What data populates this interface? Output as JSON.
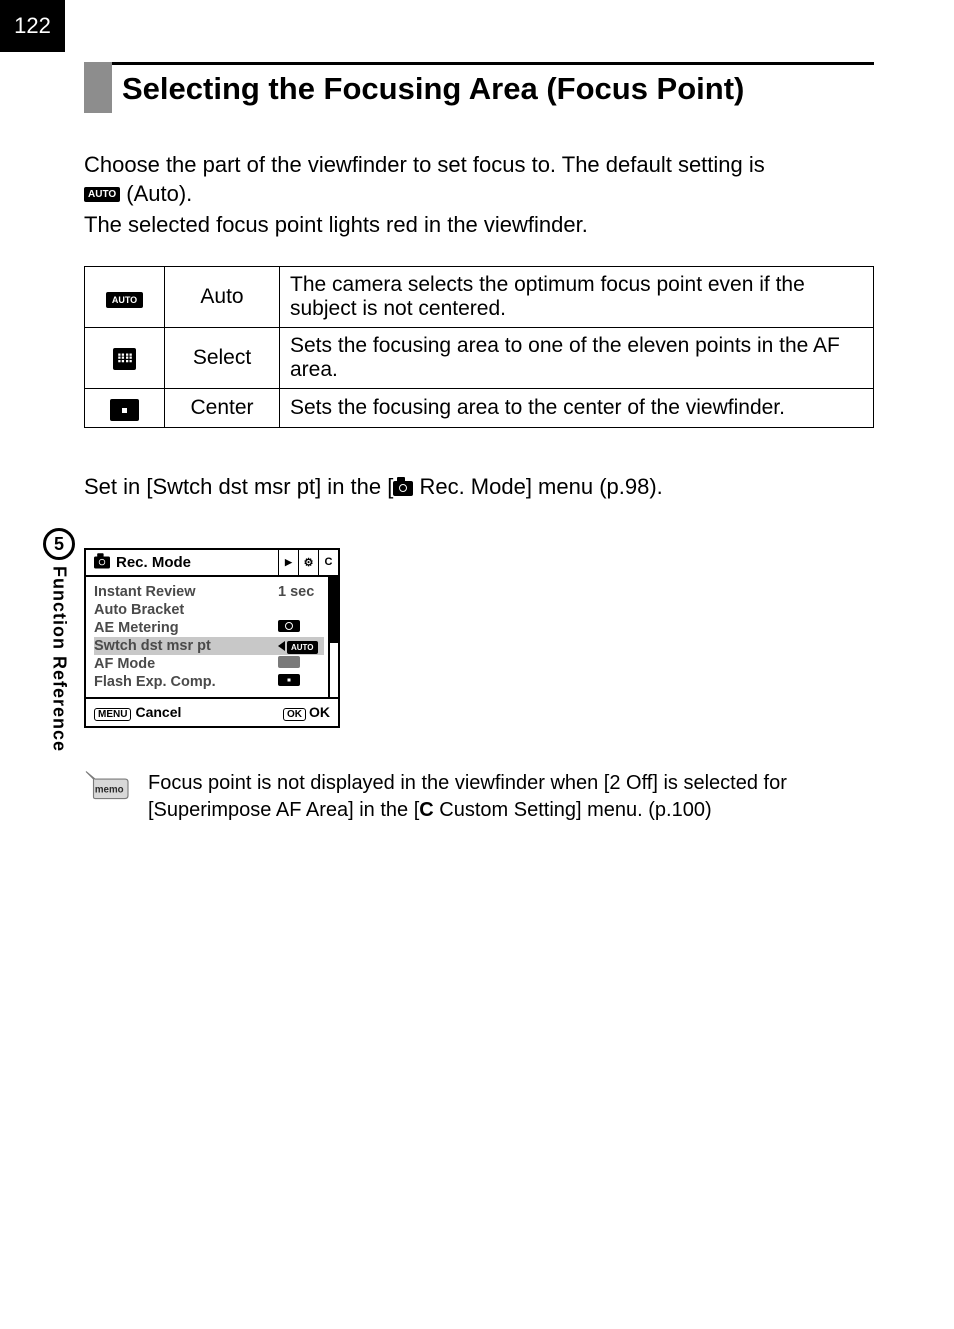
{
  "page_number": "122",
  "section_title": "Selecting the Focusing Area (Focus Point)",
  "intro_line1": "Choose the part of the viewfinder to set focus to. The default setting is",
  "intro_auto_tag": "AUTO",
  "intro_auto_label": " (Auto).",
  "intro_line2": "The selected focus point lights red in the viewfinder.",
  "options": [
    {
      "icon": "AUTO",
      "name": "Auto",
      "desc": "The camera selects the optimum focus point even if the subject is not centered."
    },
    {
      "icon": "SELECT",
      "name": "Select",
      "desc": "Sets the focusing area to one of the eleven points in the AF area."
    },
    {
      "icon": "CENTER",
      "name": "Center",
      "desc": "Sets the focusing area to the center of the viewfinder."
    }
  ],
  "set_in_prefix": "Set in [Swtch dst msr pt] in the [",
  "set_in_menu": " Rec. Mode] menu (p.98).",
  "lcd": {
    "title": "Rec. Mode",
    "tabs": [
      "▶",
      "⚙",
      "C"
    ],
    "rows": [
      {
        "label": "Instant Review",
        "value_text": "1 sec"
      },
      {
        "label": "Auto Bracket",
        "value_text": ""
      },
      {
        "label": "AE Metering",
        "value_icon": "meter"
      },
      {
        "label": "Swtch dst msr pt",
        "value_icon": "auto",
        "highlight": true,
        "arrow": true
      },
      {
        "label": "AF Mode",
        "value_icon": "af"
      },
      {
        "label": "Flash Exp. Comp.",
        "value_icon": "flash"
      }
    ],
    "footer": {
      "menu_tag": "MENU",
      "cancel": "Cancel",
      "ok_tag": "OK",
      "ok": "OK"
    }
  },
  "side": {
    "number": "5",
    "label": "Function Reference"
  },
  "memo": {
    "tag": "memo",
    "line1": "Focus point is not displayed in the viewfinder when [2 Off] is selected for",
    "line2a": "[Superimpose AF Area] in the [",
    "line2b_bold": "C",
    "line2c": " Custom Setting] menu. (p.100)"
  }
}
